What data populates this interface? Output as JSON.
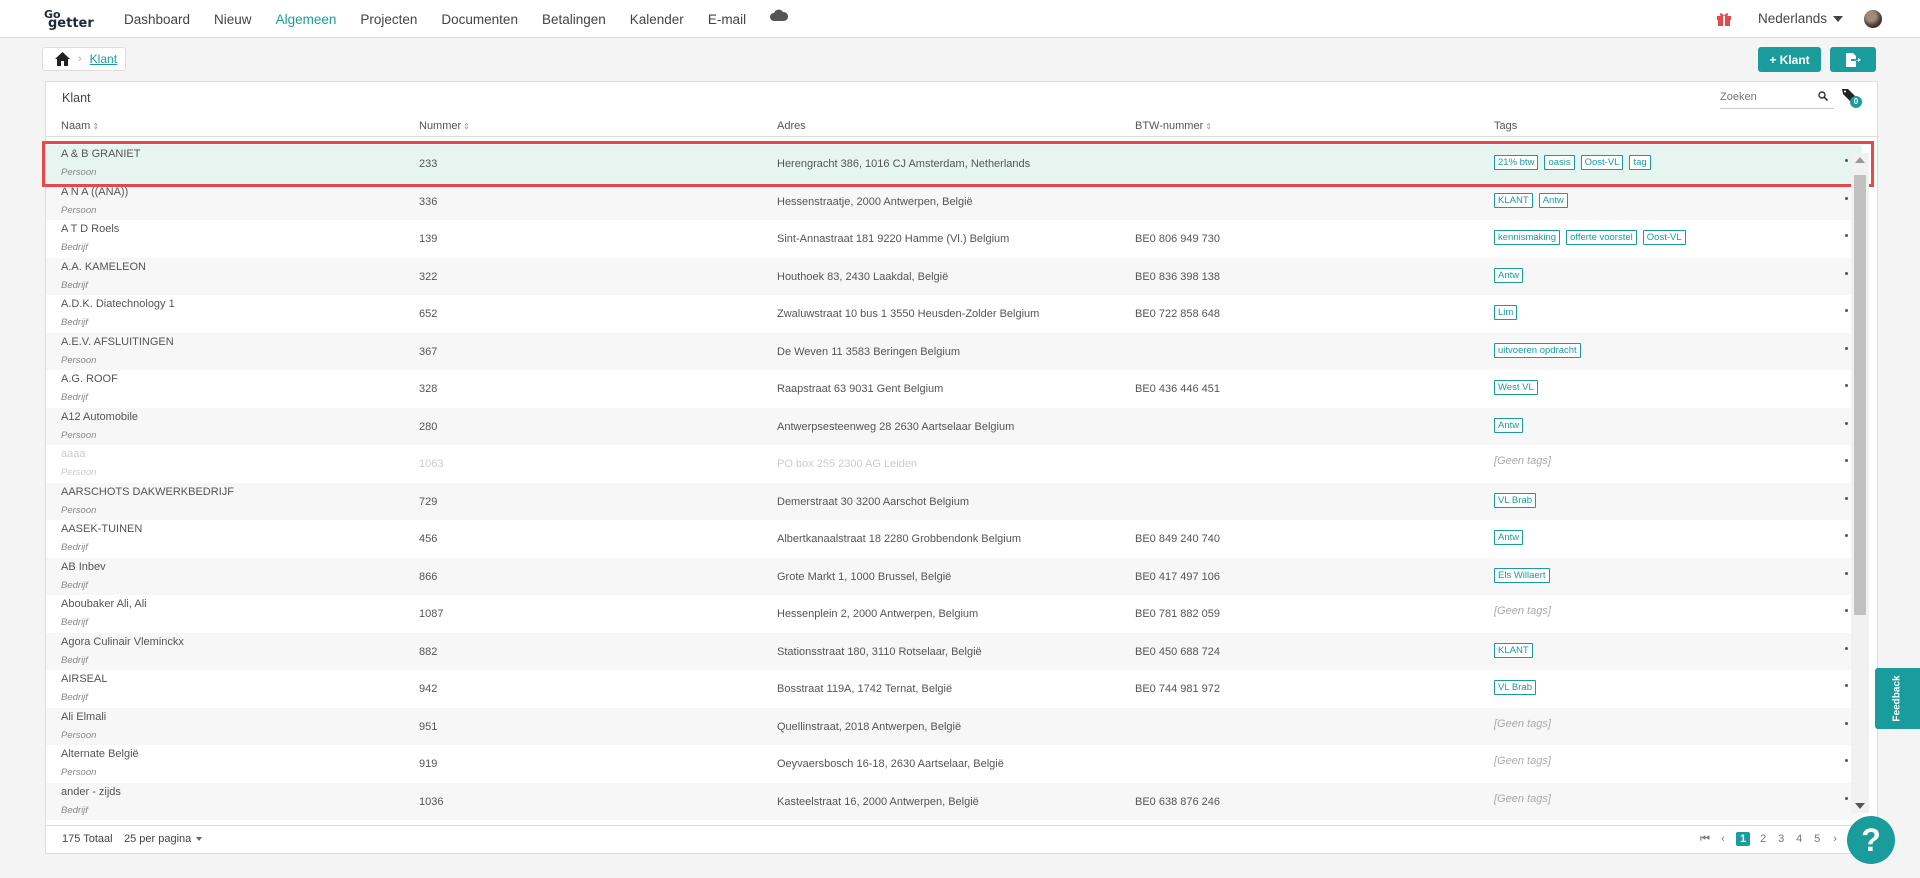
{
  "app": {
    "logo_top": "Go",
    "logo_bottom": "getter",
    "nav": [
      "Dashboard",
      "Nieuw",
      "Algemeen",
      "Projecten",
      "Documenten",
      "Betalingen",
      "Kalender",
      "E-mail"
    ],
    "active_nav": "Algemeen",
    "language": "Nederlands"
  },
  "breadcrumb": {
    "current": "Klant"
  },
  "actions": {
    "add_label": "+ Klant"
  },
  "card": {
    "title": "Klant",
    "search_placeholder": "Zoeken",
    "tag_filter_count": "0"
  },
  "table": {
    "headers": {
      "name": "Naam",
      "number": "Nummer",
      "address": "Adres",
      "btw": "BTW-nummer",
      "tags": "Tags"
    },
    "rows": [
      {
        "name": "A & B GRANIET",
        "type": "Persoon",
        "number": "233",
        "address": "Herengracht 386, 1016 CJ Amsterdam, Netherlands",
        "btw": "",
        "tags": [
          "21% btw",
          "oasis",
          "Oost-VL",
          "tag"
        ]
      },
      {
        "name": "A N A ((ANA))",
        "type": "Persoon",
        "number": "336",
        "address": "Hessenstraatje, 2000 Antwerpen, België",
        "btw": "",
        "tags": [
          "KLANT",
          "Antw"
        ]
      },
      {
        "name": "A T D Roels",
        "type": "Bedrijf",
        "number": "139",
        "address": "Sint-Annastraat 181 9220 Hamme (Vl.) Belgium",
        "btw": "BE0 806 949 730",
        "tags": [
          "kennismaking",
          "offerte voorstel",
          "Oost-VL"
        ]
      },
      {
        "name": "A.A. KAMELEON",
        "type": "Bedrijf",
        "number": "322",
        "address": "Houthoek 83, 2430 Laakdal, België",
        "btw": "BE0 836 398 138",
        "tags": [
          "Antw"
        ]
      },
      {
        "name": "A.D.K. Diatechnology 1",
        "type": "Bedrijf",
        "number": "652",
        "address": "Zwaluwstraat 10 bus 1 3550 Heusden-Zolder Belgium",
        "btw": "BE0 722 858 648",
        "tags": [
          "Lim"
        ]
      },
      {
        "name": "A.E.V. AFSLUITINGEN",
        "type": "Persoon",
        "number": "367",
        "address": "De Weven 11 3583 Beringen Belgium",
        "btw": "",
        "tags": [
          "uitvoeren opdracht"
        ]
      },
      {
        "name": "A.G. ROOF",
        "type": "Bedrijf",
        "number": "328",
        "address": "Raapstraat 63 9031 Gent Belgium",
        "btw": "BE0 436 446 451",
        "tags": [
          "West VL"
        ]
      },
      {
        "name": "A12 Automobile",
        "type": "Persoon",
        "number": "280",
        "address": "Antwerpsesteenweg 28 2630 Aartselaar Belgium",
        "btw": "",
        "tags": [
          "Antw"
        ]
      },
      {
        "name": "aaaa",
        "type": "Persoon",
        "number": "1063",
        "address": "PO box 255 2300 AG Leiden",
        "btw": "",
        "tags": []
      },
      {
        "name": "AARSCHOTS DAKWERKBEDRIJF",
        "type": "Persoon",
        "number": "729",
        "address": "Demerstraat 30 3200 Aarschot Belgium",
        "btw": "",
        "tags": [
          "VL Brab"
        ]
      },
      {
        "name": "AASEK-TUINEN",
        "type": "Bedrijf",
        "number": "456",
        "address": "Albertkanaalstraat 18 2280 Grobbendonk Belgium",
        "btw": "BE0 849 240 740",
        "tags": [
          "Antw"
        ]
      },
      {
        "name": "AB Inbev",
        "type": "Bedrijf",
        "number": "866",
        "address": "Grote Markt 1, 1000 Brussel, België",
        "btw": "BE0 417 497 106",
        "tags": [
          "Els Willaert"
        ]
      },
      {
        "name": "Aboubaker Ali, Ali",
        "type": "Bedrijf",
        "number": "1087",
        "address": "Hessenplein 2, 2000 Antwerpen, Belgium",
        "btw": "BE0 781 882 059",
        "tags": []
      },
      {
        "name": "Agora Culinair Vleminckx",
        "type": "Bedrijf",
        "number": "882",
        "address": "Stationsstraat 180, 3110 Rotselaar, België",
        "btw": "BE0 450 688 724",
        "tags": [
          "KLANT"
        ]
      },
      {
        "name": "AIRSEAL",
        "type": "Bedrijf",
        "number": "942",
        "address": "Bosstraat 119A, 1742 Ternat, België",
        "btw": "BE0 744 981 972",
        "tags": [
          "VL Brab"
        ]
      },
      {
        "name": "Ali Elmali",
        "type": "Persoon",
        "number": "951",
        "address": "Quellinstraat, 2018 Antwerpen, België",
        "btw": "",
        "tags": []
      },
      {
        "name": "Alternate België",
        "type": "Persoon",
        "number": "919",
        "address": "Oeyvaersbosch 16-18, 2630 Aartselaar, België",
        "btw": "",
        "tags": []
      },
      {
        "name": "ander - zijds",
        "type": "Bedrijf",
        "number": "1036",
        "address": "Kasteelstraat 16, 2000 Antwerpen, België",
        "btw": "BE0 638 876 246",
        "tags": []
      }
    ],
    "no_tags_label": "[Geen tags]",
    "selected_row": 0,
    "muted_row": 8
  },
  "footer": {
    "total": "175 Totaal",
    "per_page": "25 per pagina",
    "pages": [
      "1",
      "2",
      "3",
      "4",
      "5"
    ],
    "current_page": "1"
  },
  "widgets": {
    "feedback": "Feedback",
    "help": "?"
  },
  "colors": {
    "accent": "#1a9c9c",
    "highlight": "#e8474b",
    "selected_row": "#e6f5ef"
  }
}
